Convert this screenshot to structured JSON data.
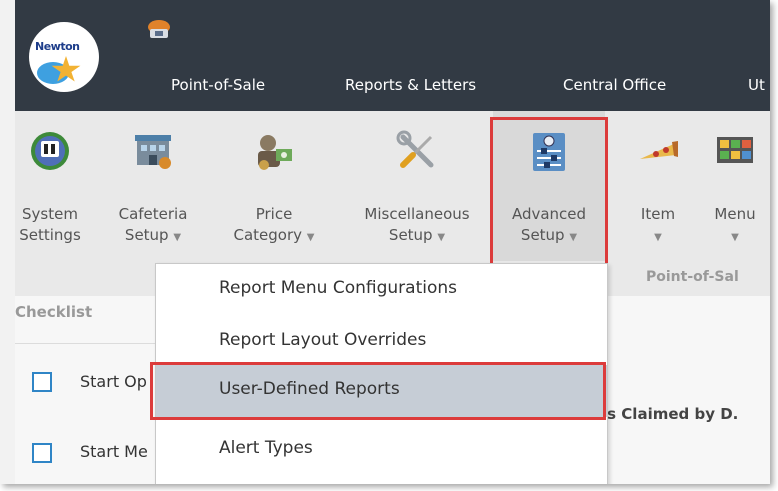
{
  "topnav": {
    "tabs": [
      {
        "label": "Point-of-Sale"
      },
      {
        "label": "Reports & Letters"
      },
      {
        "label": "Central Office"
      },
      {
        "label": "Ut"
      }
    ]
  },
  "logo": {
    "text": "Newton"
  },
  "ribbon": {
    "buttons": [
      {
        "line1": "System",
        "line2": "Settings",
        "icon": "system-settings-globe-icon",
        "dropdown": false
      },
      {
        "line1": "Cafeteria",
        "line2": "Setup",
        "icon": "cafeteria-building-icon",
        "dropdown": true
      },
      {
        "line1": "Price",
        "line2": "Category",
        "icon": "price-category-coins-icon",
        "dropdown": true
      },
      {
        "line1": "Miscellaneous",
        "line2": "Setup",
        "icon": "tools-wrench-screwdriver-icon",
        "dropdown": true
      },
      {
        "line1": "Advanced",
        "line2": "Setup",
        "icon": "advanced-setup-sliders-icon",
        "dropdown": true
      },
      {
        "line1": "Item",
        "line2": "",
        "icon": "pizza-slice-icon",
        "dropdown": true
      },
      {
        "line1": "Menu",
        "line2": "",
        "icon": "menu-board-icon",
        "dropdown": true
      }
    ],
    "group_label": "Point-of-Sal"
  },
  "checklist": {
    "header": "Checklist",
    "items": [
      {
        "label": "Start Op"
      },
      {
        "label": "Start Me"
      }
    ],
    "background_text": "ls Claimed by D."
  },
  "dropdown": {
    "items": [
      {
        "label": "Report Menu Configurations",
        "selected": false
      },
      {
        "label": "Report Layout Overrides",
        "selected": false
      },
      {
        "label": "User-Defined Reports",
        "selected": true
      },
      {
        "label": "Alert Types",
        "selected": false
      }
    ]
  },
  "colors": {
    "nav_bg": "#323a44",
    "ribbon_bg": "#e9e9e9",
    "highlight_red": "#dc3b3b",
    "selected_item_bg": "#c6cdd6",
    "checkbox_blue": "#2f85c6"
  }
}
